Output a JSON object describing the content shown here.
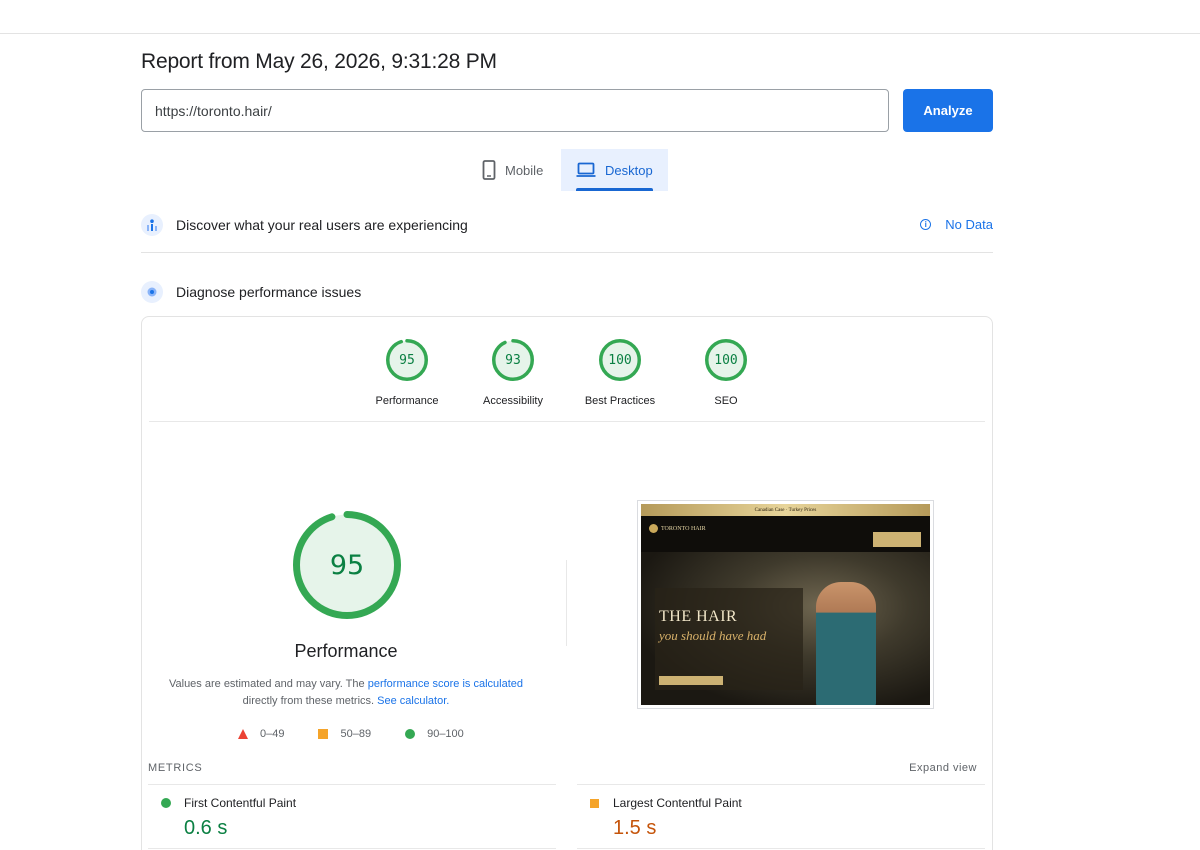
{
  "header": {
    "report_title": "Report from May 26, 2026, 9:31:28 PM",
    "url_value": "https://toronto.hair/",
    "analyze_label": "Analyze"
  },
  "tabs": [
    {
      "label": "Mobile",
      "icon": "phone-icon",
      "selected": false
    },
    {
      "label": "Desktop",
      "icon": "laptop-icon",
      "selected": true
    }
  ],
  "crux": {
    "title": "Discover what your real users are experiencing",
    "no_data_label": "No Data",
    "icon": "users-chart-icon"
  },
  "diagnose": {
    "title": "Diagnose performance issues",
    "icon": "lighthouse-icon"
  },
  "categories": [
    {
      "score": "95",
      "label": "Performance"
    },
    {
      "score": "93",
      "label": "Accessibility"
    },
    {
      "score": "100",
      "label": "Best Practices"
    },
    {
      "score": "100",
      "label": "SEO"
    }
  ],
  "performance": {
    "score": "95",
    "label": "Performance",
    "disclaimer_start": "Values are estimated and may vary. The ",
    "disclaimer_link1": "performance score is calculated",
    "disclaimer_mid": " directly from these metrics. ",
    "disclaimer_link2": "See calculator."
  },
  "legend": [
    {
      "range": "0–49",
      "shape": "triangle",
      "color": "#eb4335"
    },
    {
      "range": "50–89",
      "shape": "square",
      "color": "#f5a42a"
    },
    {
      "range": "90–100",
      "shape": "circle",
      "color": "#34a853"
    }
  ],
  "screenshot": {
    "topbar_text": "Canadian Case · Turkey Prices",
    "logo_text": "TORONTO HAIR",
    "headline": "THE HAIR",
    "subheadline": "you should have had"
  },
  "metrics": {
    "heading": "METRICS",
    "expand_label": "Expand view",
    "items": [
      {
        "name": "First Contentful Paint",
        "value": "0.6 s",
        "status": "good"
      },
      {
        "name": "Largest Contentful Paint",
        "value": "1.5 s",
        "status": "average"
      }
    ]
  },
  "colors": {
    "accent": "#1a73e8",
    "pass": "#34a853",
    "average": "#f5a42a",
    "fail": "#eb4335"
  }
}
